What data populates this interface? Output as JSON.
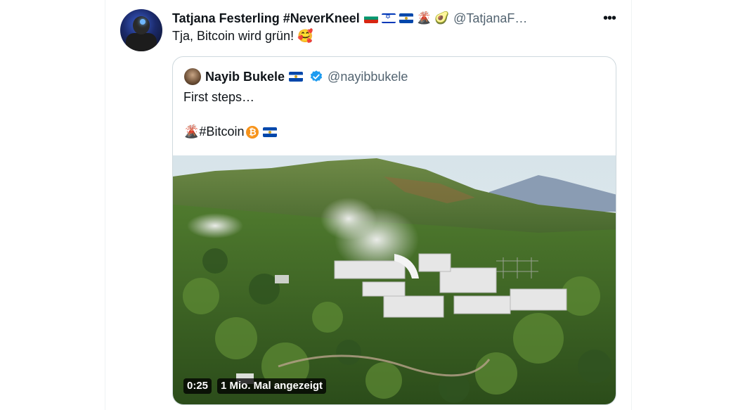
{
  "tweet": {
    "author_name": "Tatjana Festerling #NeverKneel",
    "handle": "@TatjanaF…",
    "name_emojis": [
      "flag-bulgaria",
      "flag-israel",
      "flag-el-salvador",
      "volcano",
      "avocado"
    ],
    "text": "Tja, Bitcoin wird grün! 🥰",
    "more_label": "•••"
  },
  "quote": {
    "author_name": "Nayib Bukele",
    "handle": "@nayibbukele",
    "name_emojis": [
      "flag-el-salvador",
      "verified-badge"
    ],
    "line1": "First steps…",
    "line2_prefix": "🌋",
    "line2_text": "#Bitcoin",
    "line2_emojis": [
      "bitcoin",
      "flag-el-salvador"
    ],
    "btc_symbol": "₿",
    "video": {
      "duration": "0:25",
      "views": "1 Mio. Mal angezeigt",
      "description": "aerial view of geothermal power plant in forest"
    }
  },
  "colors": {
    "text_primary": "#0f1419",
    "text_secondary": "#536471",
    "border": "#cfd9de",
    "verified": "#1d9bf0",
    "bitcoin": "#f7931a"
  }
}
